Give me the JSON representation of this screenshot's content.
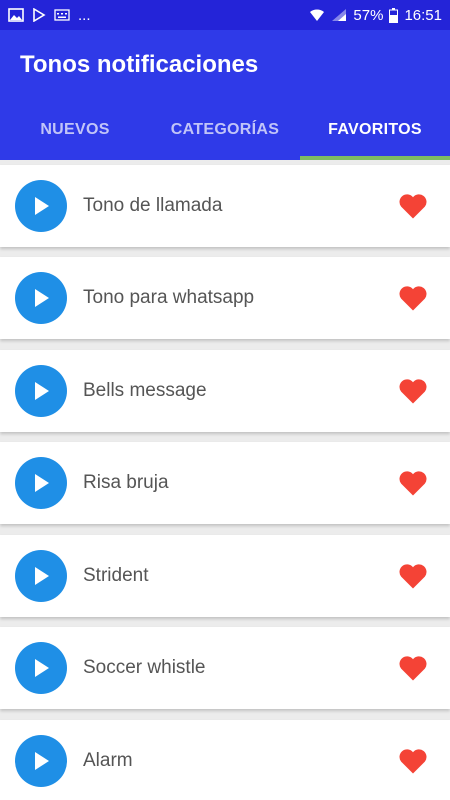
{
  "status": {
    "battery": "57%",
    "time": "16:51",
    "ellipsis": "..."
  },
  "appbar": {
    "title": "Tonos notificaciones"
  },
  "tabs": [
    {
      "label": "NUEVOS",
      "active": false
    },
    {
      "label": "CATEGORÍAS",
      "active": false
    },
    {
      "label": "FAVORITOS",
      "active": true
    }
  ],
  "favorites": [
    {
      "name": "Tono de llamada"
    },
    {
      "name": "Tono para whatsapp"
    },
    {
      "name": "Bells message"
    },
    {
      "name": "Risa bruja"
    },
    {
      "name": "Strident"
    },
    {
      "name": "Soccer whistle"
    },
    {
      "name": "Alarm"
    }
  ],
  "colors": {
    "primary": "#2f3ae8",
    "statusbar": "#2424d8",
    "play": "#1f8fe6",
    "heart": "#f44336",
    "tab_indicator": "#7dbb63"
  }
}
